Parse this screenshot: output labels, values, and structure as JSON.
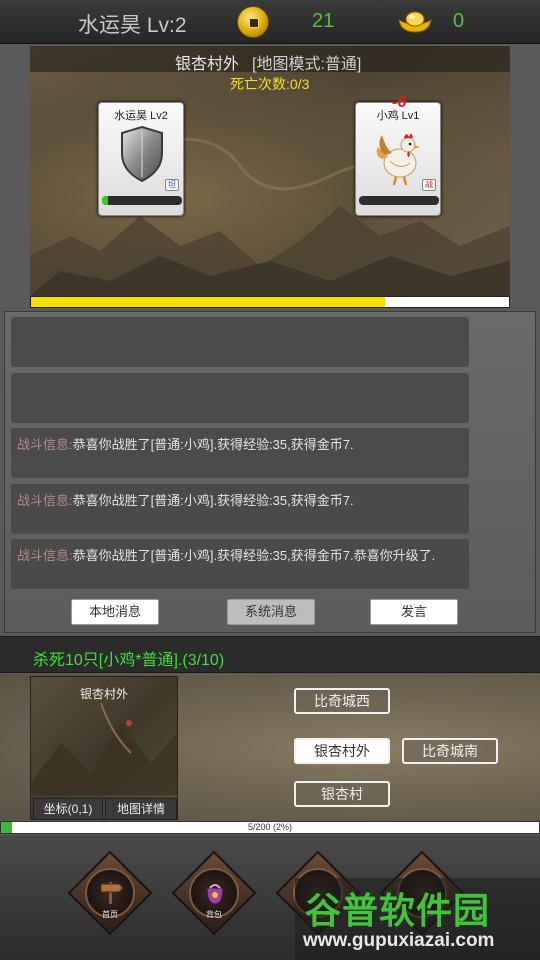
{
  "header": {
    "player_label": "水运昊 Lv:2",
    "coins": "21",
    "gold": "0"
  },
  "battle": {
    "map_name": "银杏村外",
    "map_mode": "[地图模式:普通]",
    "death_count": "死亡次数:0/3",
    "player": {
      "name": "水运昊 Lv2",
      "role_tag": "坦",
      "hp_fraction": 0.08
    },
    "enemy": {
      "name": "小鸡 Lv1",
      "role_tag": "战",
      "hp_fraction": 0.0
    },
    "damage_text": "-6",
    "progress_fraction": 0.74
  },
  "messages": {
    "items": [
      {
        "prefix": "",
        "text": ""
      },
      {
        "prefix": "",
        "text": ""
      },
      {
        "prefix": "战斗信息:",
        "text": "恭喜你战胜了[普通:小鸡].获得经验:35,获得金币7."
      },
      {
        "prefix": "战斗信息:",
        "text": "恭喜你战胜了[普通:小鸡].获得经验:35,获得金币7."
      },
      {
        "prefix": "战斗信息:",
        "text": "恭喜你战胜了[普通:小鸡].获得经验:35,获得金币7.恭喜你升级了."
      }
    ],
    "tabs": {
      "local": "本地消息",
      "system": "系统消息",
      "speak": "发言"
    }
  },
  "quest": {
    "text": "杀死10只[小鸡*普通].(3/10)"
  },
  "map_nav": {
    "minimap_title": "银杏村外",
    "coord_label": "坐标(0,1)",
    "detail_label": "地图详情",
    "destinations": {
      "west": "比奇城西",
      "current": "银杏村外",
      "south": "比奇城南",
      "village": "银杏村"
    }
  },
  "exp": {
    "text": "5/200 (2%)",
    "fraction": 0.02
  },
  "bottom_nav": {
    "home": "首页",
    "bag": "背包",
    "item3": "",
    "item4": ""
  },
  "watermark": {
    "title": "谷普软件园",
    "url": "www.gupuxiazai.com"
  },
  "colors": {
    "quest_green": "#3fe03a",
    "progress_yellow": "#f5e000",
    "hp_green": "#3cc628"
  },
  "icons": {
    "coin": "copper-coin-icon",
    "gold": "gold-ingot-icon",
    "player": "shield-icon",
    "enemy": "rooster-icon"
  }
}
